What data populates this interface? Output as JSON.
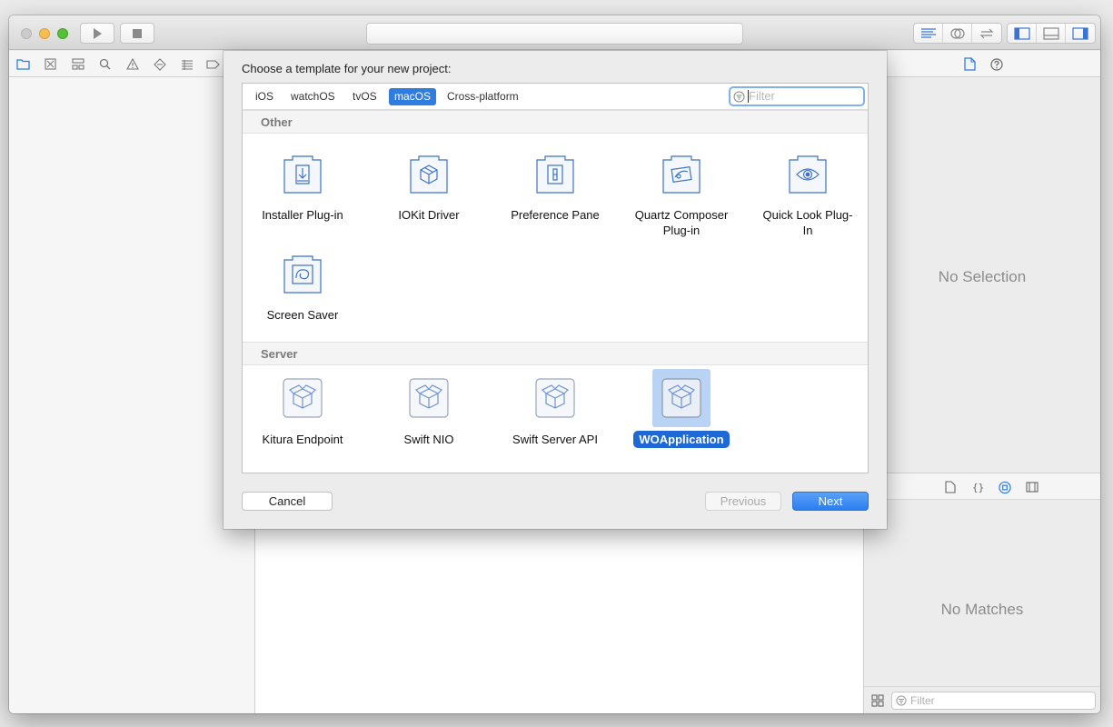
{
  "window": {
    "sheet_title": "Choose a template for your new project:",
    "platforms": [
      "iOS",
      "watchOS",
      "tvOS",
      "macOS",
      "Cross-platform"
    ],
    "selected_platform": "macOS",
    "filter": {
      "placeholder": "Filter"
    },
    "sections": [
      {
        "name": "Other",
        "templates": [
          {
            "label": "Installer Plug-in",
            "icon": "installer-icon"
          },
          {
            "label": "IOKit Driver",
            "icon": "cube-icon"
          },
          {
            "label": "Preference Pane",
            "icon": "switch-icon"
          },
          {
            "label": "Quartz Composer Plug-in",
            "icon": "quartz-icon"
          },
          {
            "label": "Quick Look Plug-In",
            "icon": "eye-icon"
          },
          {
            "label": "Screen Saver",
            "icon": "swirl-icon"
          }
        ]
      },
      {
        "name": "Server",
        "templates": [
          {
            "label": "Kitura Endpoint",
            "icon": "box-icon"
          },
          {
            "label": "Swift NIO",
            "icon": "box-icon"
          },
          {
            "label": "Swift Server API",
            "icon": "box-icon"
          },
          {
            "label": "WOApplication",
            "icon": "box-icon",
            "selected": true
          }
        ]
      }
    ],
    "buttons": {
      "cancel": "Cancel",
      "previous": "Previous",
      "next": "Next"
    }
  },
  "inspector": {
    "no_selection": "No Selection",
    "no_matches": "No Matches",
    "library_filter_placeholder": "Filter"
  },
  "colors": {
    "accent": "#2f7de1",
    "selection": "#1f69d6",
    "icon_stroke": "#3f72c4"
  }
}
